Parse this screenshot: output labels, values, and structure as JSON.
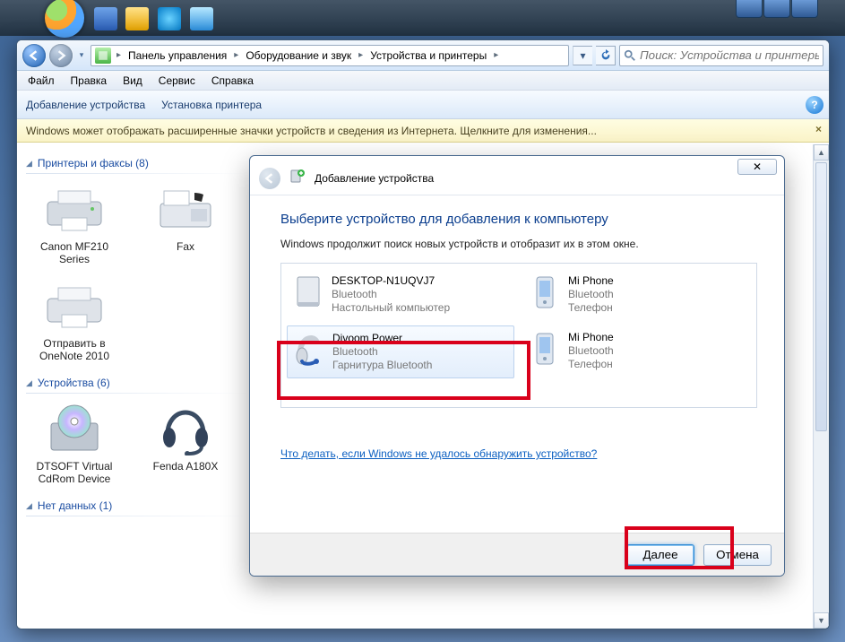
{
  "taskbar": {},
  "address": {
    "back_tip": "Назад",
    "forward_tip": "Вперёд",
    "crumbs": [
      "Панель управления",
      "Оборудование и звук",
      "Устройства и принтеры"
    ],
    "search_placeholder": "Поиск: Устройства и принтеры"
  },
  "menu": {
    "items": [
      "Файл",
      "Правка",
      "Вид",
      "Сервис",
      "Справка"
    ]
  },
  "commands": {
    "add_device": "Добавление устройства",
    "add_printer": "Установка принтера"
  },
  "infobar": {
    "text": "Windows может отображать расширенные значки устройств и сведения из Интернета.  Щелкните для изменения..."
  },
  "groups": {
    "printers": {
      "title": "Принтеры и факсы",
      "count": 8
    },
    "devices": {
      "title": "Устройства",
      "count": 6
    },
    "nodata": {
      "title": "Нет данных",
      "count": 1
    }
  },
  "printers": [
    {
      "name": "Canon MF210 Series"
    },
    {
      "name": "Fax"
    }
  ],
  "printers2": [
    {
      "name": "Отправить в OneNote 2010"
    }
  ],
  "devices": [
    {
      "name": "DTSOFT Virtual CdRom Device"
    },
    {
      "name": "Fenda A180X"
    }
  ],
  "wizard": {
    "title": "Добавление устройства",
    "heading": "Выберите устройство для добавления к компьютеру",
    "subheading": "Windows продолжит поиск новых устройств и отобразит их в этом окне.",
    "help_link": "Что делать, если Windows не удалось обнаружить устройство?",
    "next": "Далее",
    "cancel": "Отмена",
    "close_glyph": "✕",
    "devices": [
      {
        "name": "DESKTOP-N1UQVJ7",
        "line2": "Bluetooth",
        "line3": "Настольный компьютер"
      },
      {
        "name": "Mi Phone",
        "line2": "Bluetooth",
        "line3": "Телефон"
      },
      {
        "name": "Divoom Power",
        "line2": "Bluetooth",
        "line3": "Гарнитура Bluetooth",
        "selected": true
      },
      {
        "name": "Mi Phone",
        "line2": "Bluetooth",
        "line3": "Телефон"
      }
    ]
  }
}
